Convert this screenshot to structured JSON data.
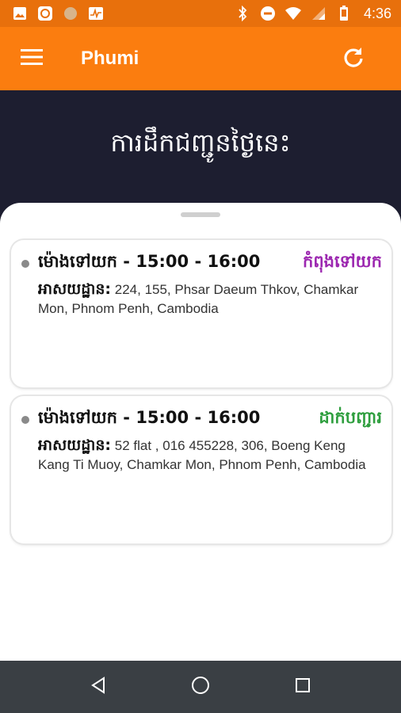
{
  "status_bar": {
    "time": "4:36",
    "left_icons": [
      "image-icon",
      "app-icon",
      "circle-icon",
      "activity-icon"
    ],
    "right_icons": [
      "bluetooth-icon",
      "do-not-disturb-icon",
      "wifi-icon",
      "signal-icon",
      "battery-icon"
    ]
  },
  "app_bar": {
    "title": "Phumi",
    "menu_icon": "menu-icon",
    "refresh_icon": "refresh-icon"
  },
  "header": {
    "title": "ការដឹកជញ្ជូនថ្ងៃនេះ"
  },
  "deliveries": [
    {
      "time_label": "ម៉ោងទៅយក - 15:00 - 16:00",
      "status": "កំពុងទៅយក",
      "status_color": "#9c27b0",
      "address_label": "អាសយដ្ឋាន:",
      "address": " 224, 155, Phsar Daeum Thkov, Chamkar Mon, Phnom Penh, Cambodia"
    },
    {
      "time_label": "ម៉ោងទៅយក - 15:00 - 16:00",
      "status": "ដាក់បញ្ជារ",
      "status_color": "#2e9e3e",
      "address_label": "អាសយដ្ឋាន:",
      "address": " 52 flat , 016 455228, 306, Boeng Keng Kang Ti Muoy, Chamkar Mon, Phnom Penh, Cambodia"
    }
  ],
  "nav_bar": {
    "buttons": [
      "back-icon",
      "home-icon",
      "recents-icon"
    ]
  },
  "colors": {
    "status_bar": "#e8700c",
    "app_bar": "#fb7d0f",
    "header_band": "#1d1e30",
    "nav_bar": "#3a3f44"
  }
}
